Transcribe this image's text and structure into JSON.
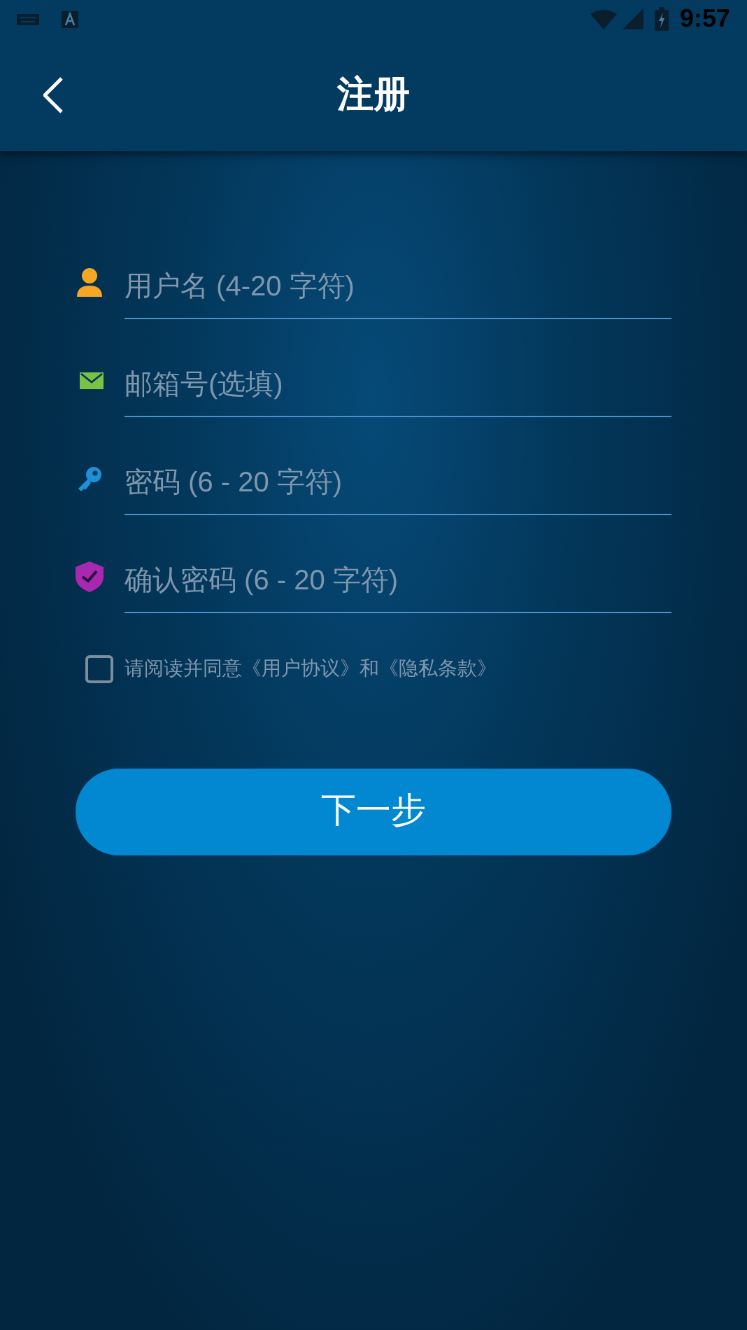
{
  "status_bar": {
    "time": "9:57"
  },
  "header": {
    "title": "注册"
  },
  "fields": [
    {
      "kind": "user",
      "placeholder": "用户名 (4-20 字符)"
    },
    {
      "kind": "email",
      "placeholder": "邮箱号(选填)"
    },
    {
      "kind": "key",
      "placeholder": "密码 (6 - 20 字符)"
    },
    {
      "kind": "shield",
      "placeholder": "确认密码 (6 - 20 字符)"
    }
  ],
  "agreement": {
    "checked": false,
    "text": "请阅读并同意《用户协议》和《隐私条款》"
  },
  "next_button": {
    "label": "下一步"
  }
}
